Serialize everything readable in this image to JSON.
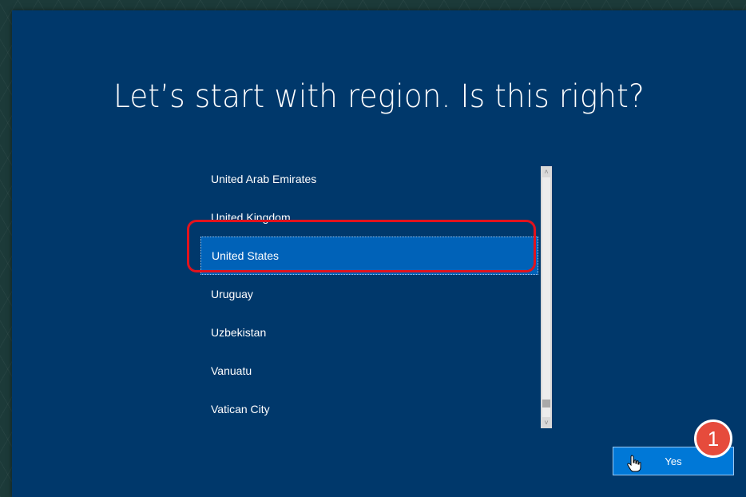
{
  "window": {
    "title": "Let’s start with region. Is this right?"
  },
  "region_list": {
    "items": [
      {
        "label": "United Arab Emirates"
      },
      {
        "label": "United Kingdom"
      },
      {
        "label": "United States",
        "selected": true
      },
      {
        "label": "Uruguay"
      },
      {
        "label": "Uzbekistan"
      },
      {
        "label": "Vanuatu"
      },
      {
        "label": "Vatican City"
      }
    ]
  },
  "scrollbar": {
    "up_icon": "chevron-up-icon",
    "down_icon": "chevron-down-icon",
    "up_glyph": "˄",
    "down_glyph": "˅"
  },
  "actions": {
    "yes_label": "Yes",
    "cursor_icon": "hand-pointer-icon"
  },
  "annotation": {
    "step_number": "1",
    "badge_color": "#e64b3c",
    "ring_color": "#e2131d"
  },
  "colors": {
    "panel_background": "#00386b",
    "selected_item": "#0062b8",
    "button_accent": "#0078d7"
  }
}
